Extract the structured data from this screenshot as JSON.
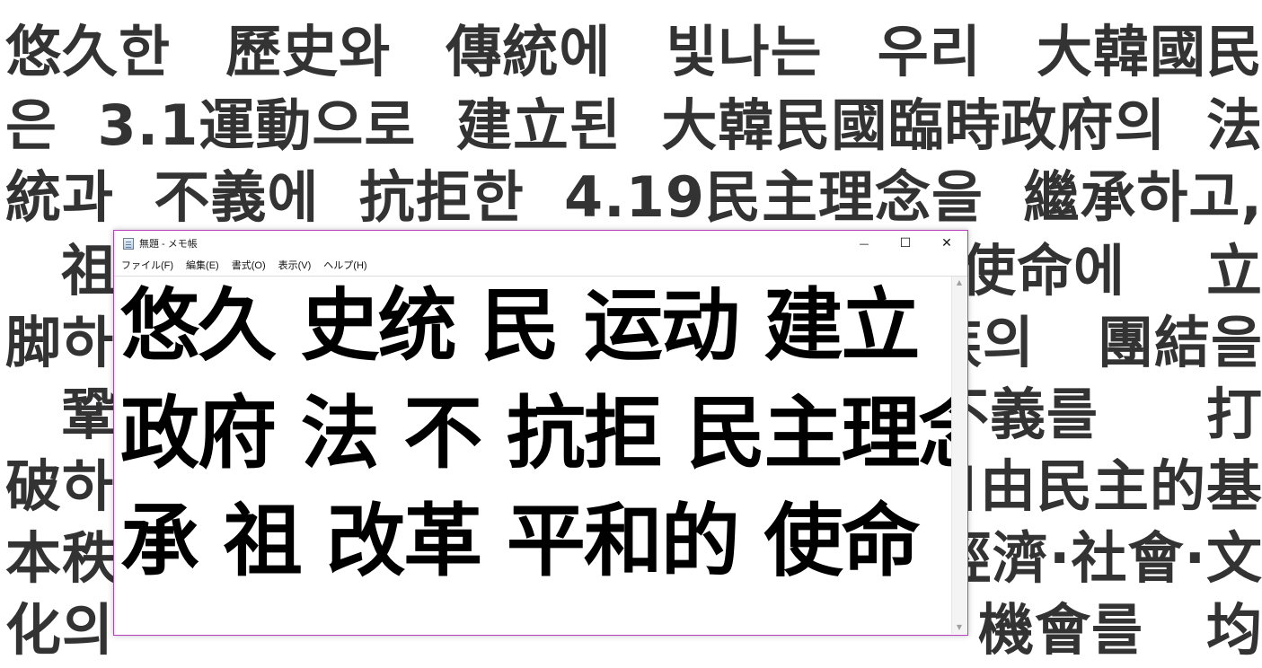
{
  "background": {
    "lines": [
      [
        "悠久한",
        "歷史와",
        "傳統에",
        "빛나는",
        "우리",
        "大韓國民"
      ],
      [
        "은",
        "3.1運動으로",
        "建立된",
        "大韓民國臨時政府의",
        "法"
      ],
      [
        "統과",
        "不義에",
        "抗拒한",
        "4.19民主理念을",
        "繼承하고,"
      ],
      [
        "祖",
        "使命에",
        "立"
      ],
      [
        "脚하",
        "族의",
        "團結을"
      ],
      [
        "鞏",
        "不義를",
        "打"
      ],
      [
        "破하",
        "自由民主的基"
      ],
      [
        "本秩",
        "經濟·社會·文"
      ],
      [
        "化의",
        "機會를",
        "均"
      ]
    ]
  },
  "window": {
    "title": "無題 - メモ帳",
    "controls": {
      "minimize": "—",
      "maximize": "☐",
      "close": "✕"
    },
    "menu": [
      "ファイル(F)",
      "編集(E)",
      "書式(O)",
      "表示(V)",
      "ヘルプ(H)"
    ],
    "editor_lines": [
      "悠久 史统 民 运动 建立",
      "政府 法 不 抗拒 民主理念",
      "承 祖 改革 平和的 使命"
    ]
  },
  "icons": {
    "app": "notepad-icon",
    "scroll_up": "scroll-up-arrow-icon",
    "scroll_down": "scroll-down-arrow-icon"
  }
}
